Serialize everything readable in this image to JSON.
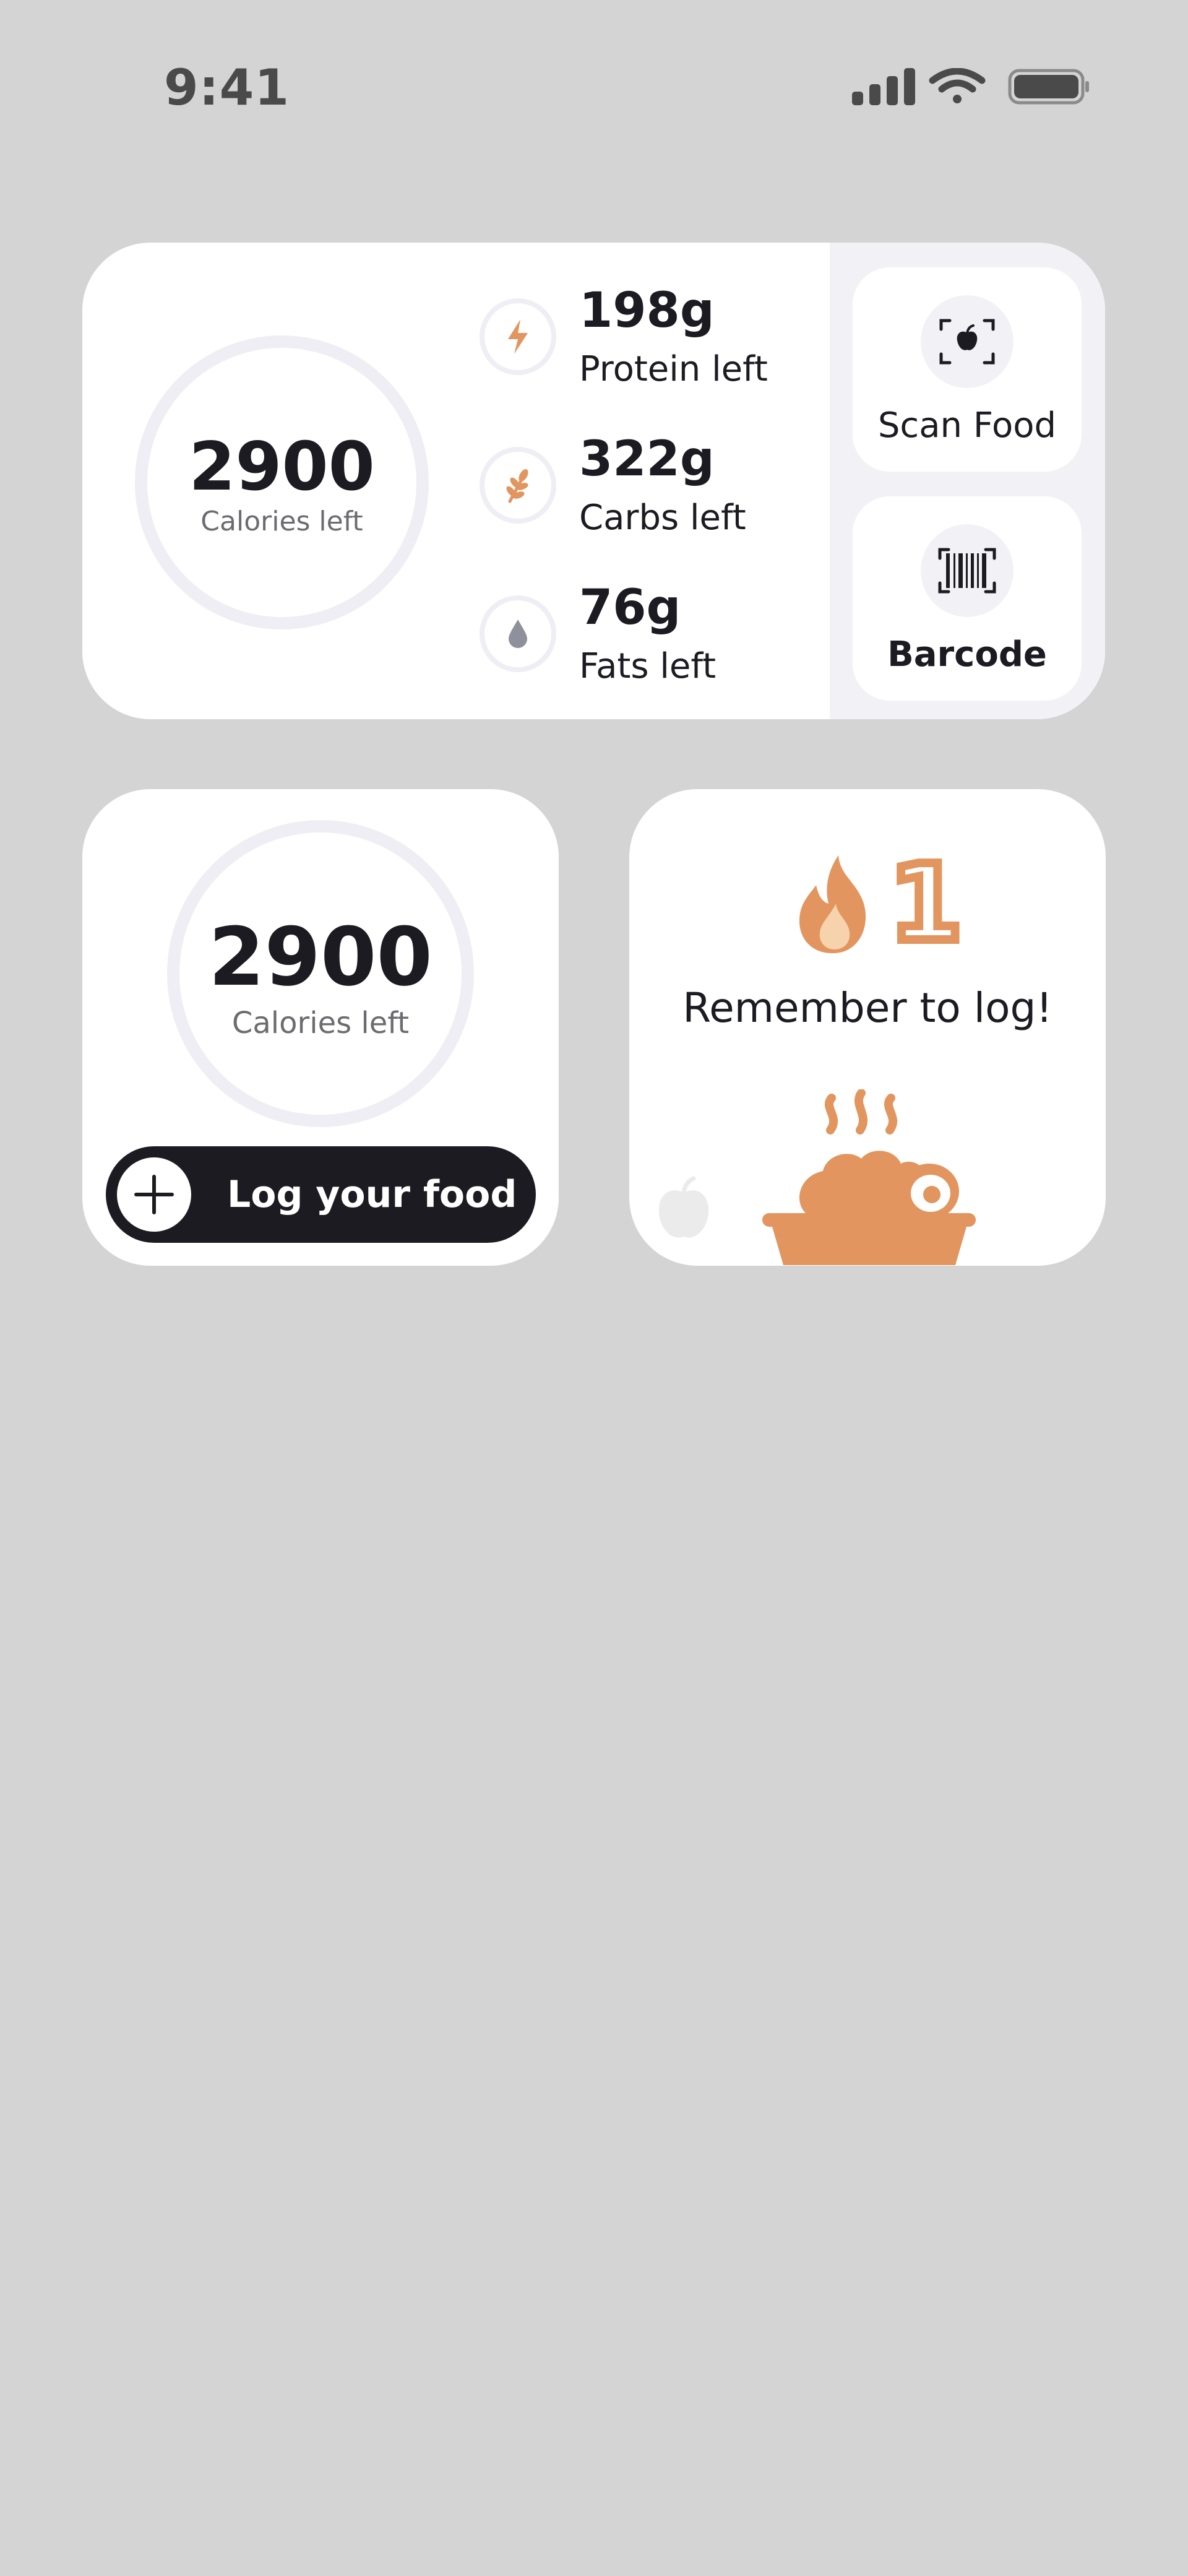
{
  "status_bar": {
    "time": "9:41",
    "icons": [
      "signal-icon",
      "wifi-icon",
      "battery-icon"
    ]
  },
  "large_widget": {
    "calories": {
      "value": "2900",
      "label": "Calories left"
    },
    "macros": [
      {
        "value": "198g",
        "label": "Protein left",
        "icon": "lightning-icon",
        "color": "#e2955e"
      },
      {
        "value": "322g",
        "label": "Carbs left",
        "icon": "wheat-icon",
        "color": "#e2955e"
      },
      {
        "value": "76g",
        "label": "Fats left",
        "icon": "drop-icon",
        "color": "#8e919c"
      }
    ],
    "actions": [
      {
        "label": "Scan Food",
        "icon": "scan-apple-icon"
      },
      {
        "label": "Barcode",
        "icon": "barcode-icon"
      }
    ]
  },
  "small_widget": {
    "calories": {
      "value": "2900",
      "label": "Calories left"
    },
    "button_label": "Log your food"
  },
  "streak_widget": {
    "count": "1",
    "message": "Remember to log!",
    "icons": [
      "flame-icon",
      "apple-icon",
      "food-dish-icon"
    ]
  },
  "colors": {
    "background": "#d4d4d4",
    "card": "#ffffff",
    "accent": "#e2955e",
    "dark": "#1c1b22",
    "ring": "#eeeef4",
    "panel": "#f2f2f6"
  }
}
